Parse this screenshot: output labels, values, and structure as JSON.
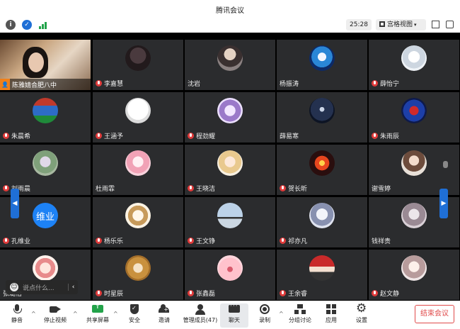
{
  "window": {
    "title": "腾讯会议"
  },
  "statusbar": {
    "timer": "25:28",
    "view_label": "宫格视图",
    "icons": [
      "info-icon",
      "shield-icon",
      "signal-icon",
      "exit-fullscreen-icon",
      "float-window-icon"
    ]
  },
  "participants": [
    {
      "name": "陈雅婧合肥八中",
      "avatar": "webcam-video",
      "host": true
    },
    {
      "name": "李嘉慧",
      "avatar": "dark-cartoon",
      "muted": true
    },
    {
      "name": "沈岩",
      "avatar": "portrait"
    },
    {
      "name": "杨振涛",
      "avatar": "galaxy-cat"
    },
    {
      "name": "薛怡宁",
      "avatar": "sheep",
      "muted": true
    },
    {
      "name": "朱晨希",
      "avatar": "pixel-sky",
      "muted": true
    },
    {
      "name": "王涵予",
      "avatar": "sketch",
      "muted": true
    },
    {
      "name": "程劲耀",
      "avatar": "anime-cat",
      "muted": true
    },
    {
      "name": "薛易寒",
      "avatar": "dark-figure"
    },
    {
      "name": "朱雨辰",
      "avatar": "superman",
      "muted": true
    },
    {
      "name": "刘雨晨",
      "avatar": "green-fig",
      "muted": true
    },
    {
      "name": "杜雨霏",
      "avatar": "pink-anime"
    },
    {
      "name": "王晓洁",
      "avatar": "blonde-anime",
      "muted": true
    },
    {
      "name": "贺长昕",
      "avatar": "fire-orb",
      "muted": true
    },
    {
      "name": "谢雪婷",
      "avatar": "girl-photo"
    },
    {
      "name": "孔维业",
      "avatar": "text",
      "avatar_text": "维业",
      "muted": true
    },
    {
      "name": "杨乐乐",
      "avatar": "dog-cartoon",
      "muted": true
    },
    {
      "name": "王文铮",
      "avatar": "couple-bike",
      "muted": true
    },
    {
      "name": "祁亦凡",
      "avatar": "anime-boy",
      "muted": true
    },
    {
      "name": "钱祥贵",
      "avatar": "figure-photo"
    },
    {
      "name": "张璐怡",
      "avatar": "chibi"
    },
    {
      "name": "时星辰",
      "avatar": "shiba",
      "muted": true
    },
    {
      "name": "张鑫磊",
      "avatar": "pig",
      "muted": true
    },
    {
      "name": "王余睿",
      "avatar": "flag-person",
      "muted": true
    },
    {
      "name": "赵文静",
      "avatar": "anime-girl",
      "muted": true
    }
  ],
  "chat": {
    "placeholder": "说点什么..."
  },
  "toolbar": {
    "mute": "静音",
    "stop_video": "停止视频",
    "share_screen": "共享屏幕",
    "security": "安全",
    "invite": "邀请",
    "members": "管理成员(47)",
    "chat": "聊天",
    "record": "录制",
    "breakout": "分组讨论",
    "apps": "应用",
    "settings": "设置",
    "end_meeting": "结束会议"
  },
  "colors": {
    "accent": "#1f6fd6",
    "end": "#e04a4a",
    "tile": "#2b2c2e"
  }
}
